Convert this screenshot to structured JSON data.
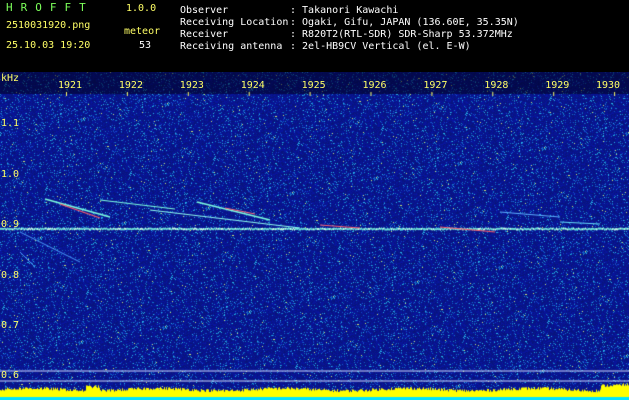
{
  "app": {
    "brand": "HROFFT",
    "version": "1.0.0"
  },
  "file": {
    "name": "2510031920.png",
    "datetime": "25.10.03 19:20"
  },
  "meteor": {
    "label": "meteor",
    "count": "53"
  },
  "info": {
    "observer_label": "Observer",
    "observer_value": ": Takanori Kawachi",
    "location_label": "Receiving Location",
    "location_value": ": Ogaki, Gifu, JAPAN (136.60E, 35.35N)",
    "receiver_label": "Receiver",
    "receiver_value": ": R820T2(RTL-SDR) SDR-Sharp 53.372MHz",
    "antenna_label": "Receiving antenna",
    "antenna_value": ": 2el-HB9CV Vertical (el. E-W)"
  },
  "axis": {
    "unit": "kHz",
    "y_ticks": [
      "1.1",
      "1.0",
      "0.9",
      "0.8",
      "0.7",
      "0.6"
    ],
    "x_ticks": [
      "1921",
      "1922",
      "1923",
      "1924",
      "1925",
      "1926",
      "1927",
      "1928",
      "1929",
      "1930"
    ]
  },
  "colors": {
    "background": "#000000",
    "spectrum_base": "#0a1a8a",
    "text_green": "#7cff5a",
    "text_yellow": "#ffff66",
    "signal_line": "#7dffe0",
    "power_yellow": "#ffff00",
    "power_cyan": "#00e5ff"
  }
}
